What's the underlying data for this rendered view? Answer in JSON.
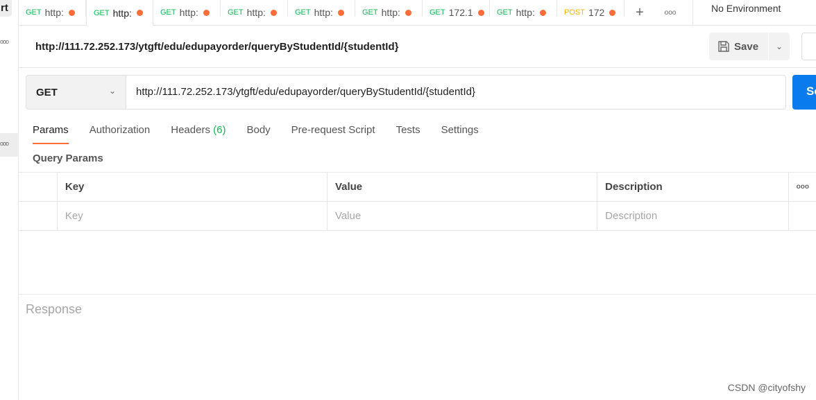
{
  "sidebar": {
    "top_button": "rt",
    "dots": "ooo"
  },
  "tabs": [
    {
      "method": "GET",
      "label": "http:"
    },
    {
      "method": "GET",
      "label": "http:"
    },
    {
      "method": "GET",
      "label": "http:"
    },
    {
      "method": "GET",
      "label": "http:"
    },
    {
      "method": "GET",
      "label": "http:"
    },
    {
      "method": "GET",
      "label": "http:"
    },
    {
      "method": "GET",
      "label": "172.1"
    },
    {
      "method": "GET",
      "label": "http:"
    },
    {
      "method": "POST",
      "label": "172"
    }
  ],
  "tab_actions": {
    "add": "+",
    "more": "ooo"
  },
  "environment": "No Environment",
  "request": {
    "title": "http://111.72.252.173/ytgft/edu/edupayorder/queryByStudentId/{studentId}",
    "method": "GET",
    "url": "http://111.72.252.173/ytgft/edu/edupayorder/queryByStudentId/{studentId}",
    "save": "Save",
    "send": "Se"
  },
  "request_tabs": [
    {
      "label": "Params"
    },
    {
      "label": "Authorization"
    },
    {
      "label": "Headers",
      "count": "(6)"
    },
    {
      "label": "Body"
    },
    {
      "label": "Pre-request Script"
    },
    {
      "label": "Tests"
    },
    {
      "label": "Settings"
    }
  ],
  "query_params": {
    "title": "Query Params",
    "columns": [
      "Key",
      "Value",
      "Description"
    ],
    "more": "ooo",
    "placeholders": [
      "Key",
      "Value",
      "Description"
    ]
  },
  "response": {
    "label": "Response"
  },
  "watermark": "CSDN @cityofshy",
  "colors": {
    "accent": "#ff6c37",
    "send": "#097bed",
    "get": "#0cbb52",
    "post": "#ffb400"
  }
}
